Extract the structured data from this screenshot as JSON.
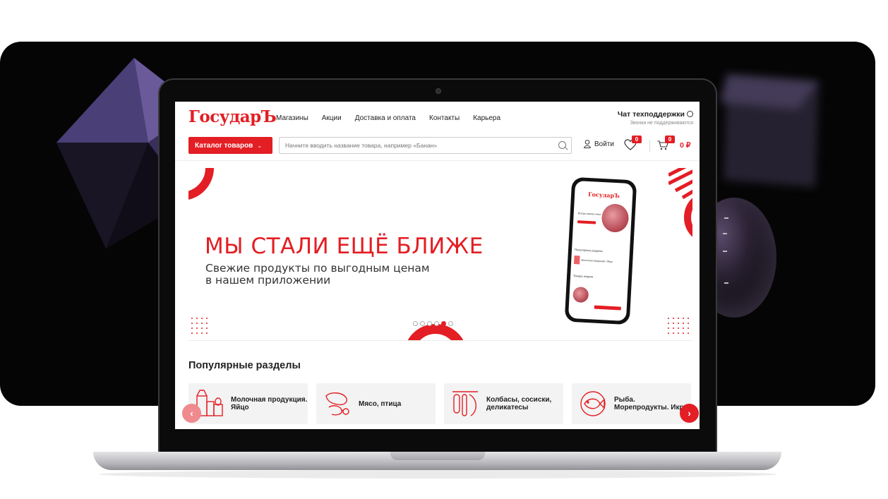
{
  "header": {
    "logo": "ГосударЪ",
    "nav": [
      "Магазины",
      "Акции",
      "Доставка и оплата",
      "Контакты",
      "Карьера"
    ],
    "support_title": "Чат техподдержки",
    "support_sub": "Звонки не поддерживаются"
  },
  "toolbar": {
    "catalog_label": "Каталог товаров",
    "search_placeholder": "Начните вводить название товара, например «Банан»",
    "login_label": "Войти",
    "favorites_count": "0",
    "cart_count": "0",
    "cart_total": "0 ₽"
  },
  "banner": {
    "title": "МЫ СТАЛИ ЕЩЁ БЛИЖЕ",
    "subtitle_line1": "Свежие продукты по выгодным ценам",
    "subtitle_line2": "в нашем приложении",
    "slides_total": 6,
    "active_slide": 5,
    "phone": {
      "logo": "ГосударЪ",
      "promo": "Всегда свежее мясо",
      "popular": "Популярные разделы",
      "category": "Молочная продукция. Яйцо",
      "products": "Товары недели"
    }
  },
  "popular": {
    "title": "Популярные разделы",
    "categories": [
      {
        "label": "Молочная продукция. Яйцо",
        "icon": "dairy-icon"
      },
      {
        "label": "Мясо, птица",
        "icon": "meat-icon"
      },
      {
        "label": "Колбасы, сосиски, деликатесы",
        "icon": "sausage-icon"
      },
      {
        "label": "Рыба. Морепродукты. Икра",
        "icon": "fish-icon"
      }
    ],
    "prev_label": "‹",
    "next_label": "›"
  },
  "colors": {
    "accent": "#e31e24",
    "dark_bg": "#050505"
  }
}
